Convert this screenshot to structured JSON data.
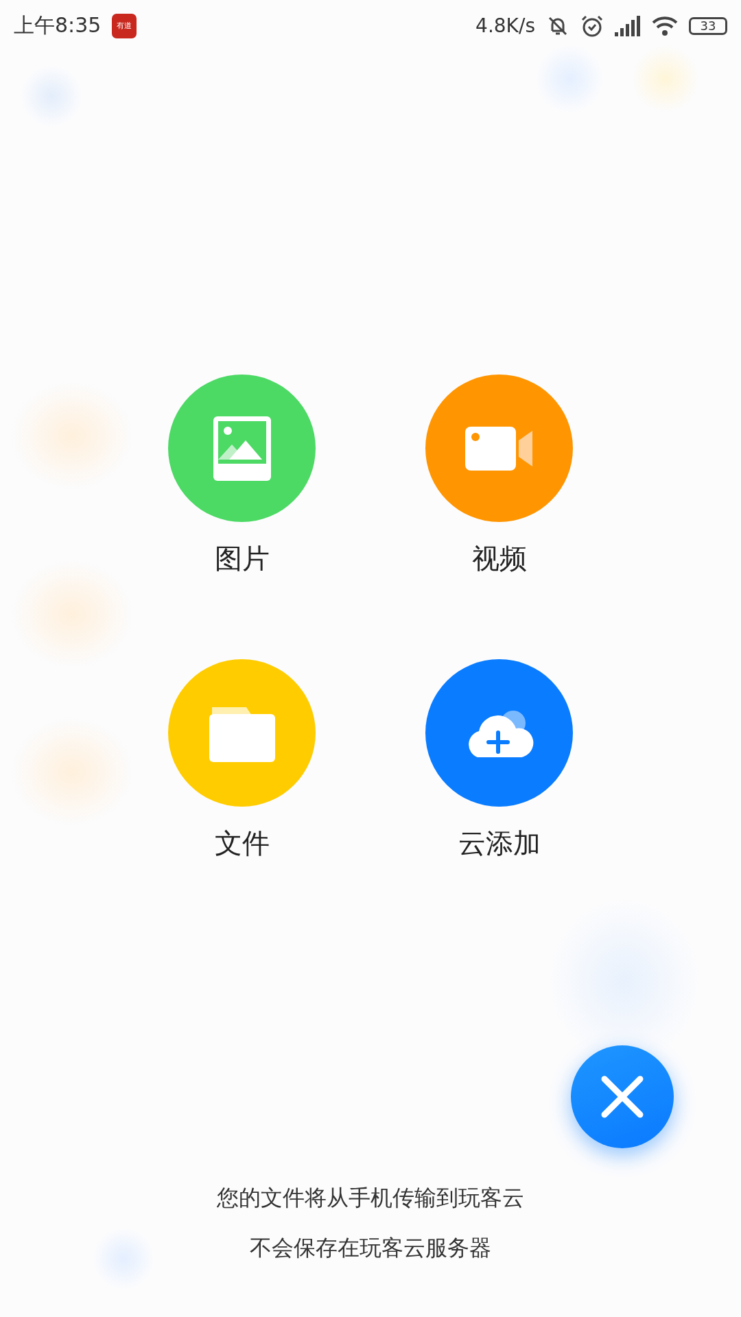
{
  "status_bar": {
    "time": "上午8:35",
    "app_badge": "有道",
    "net_speed": "4.8K/s",
    "battery": "33"
  },
  "options": [
    {
      "kind": "image",
      "label": "图片",
      "color": "#4cd964"
    },
    {
      "kind": "video",
      "label": "视频",
      "color": "#ff9500"
    },
    {
      "kind": "folder",
      "label": "文件",
      "color": "#ffcc00"
    },
    {
      "kind": "cloud",
      "label": "云添加",
      "color": "#0a7cff"
    }
  ],
  "notice": [
    "您的文件将从手机传输到玩客云",
    "不会保存在玩客云服务器"
  ]
}
